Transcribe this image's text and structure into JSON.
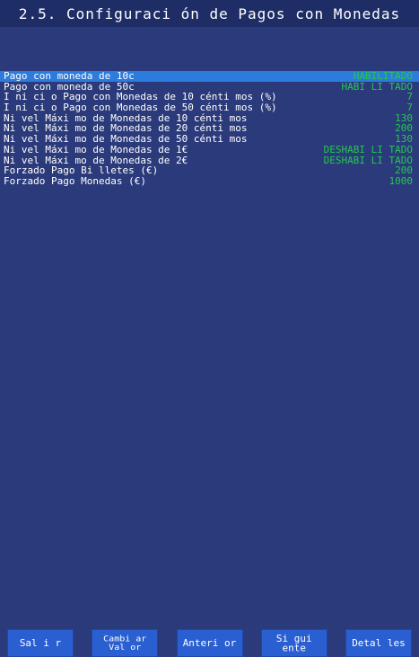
{
  "title": "2.5. Configuraci ón de Pagos con Monedas",
  "rows": [
    {
      "label": "Pago con moneda de 10c",
      "value": "HABILITADO",
      "selected": true
    },
    {
      "label": "Pago con moneda de 50c",
      "value": "HABI LI TADO",
      "selected": false
    },
    {
      "label": "I ni ci o Pago con Monedas de 10 cénti mos (%)",
      "value": "7",
      "selected": false
    },
    {
      "label": "I ni ci o Pago con Monedas de 50 cénti mos (%)",
      "value": "7",
      "selected": false
    },
    {
      "label": "Ni vel Máxi mo de Monedas de 10 cénti mos",
      "value": "130",
      "selected": false
    },
    {
      "label": "Ni vel Máxi mo de Monedas de 20 cénti mos",
      "value": "200",
      "selected": false
    },
    {
      "label": "Ni vel Máxi mo de Monedas de 50 cénti mos",
      "value": "130",
      "selected": false
    },
    {
      "label": "Ni vel Máxi mo de Monedas de 1€",
      "value": "DESHABI LI TADO",
      "selected": false
    },
    {
      "label": "Ni vel Máxi mo de Monedas de 2€",
      "value": "DESHABI LI TADO",
      "selected": false
    },
    {
      "label": "Forzado Pago Bi lletes (€)",
      "value": "200",
      "selected": false
    },
    {
      "label": "Forzado Pago Monedas (€)",
      "value": "1000",
      "selected": false
    }
  ],
  "buttons": [
    {
      "label": "Sal i r"
    },
    {
      "label": "Cambi ar\nVal or"
    },
    {
      "label": "Anteri or"
    },
    {
      "label": "Si gui ente"
    },
    {
      "label": "Detal les"
    }
  ],
  "colors": {
    "background": "#2b3a7a",
    "titlebar": "#1f2d66",
    "selected_row": "#2d7bdc",
    "value_text": "#22c84f",
    "button": "#2a5fd1"
  }
}
